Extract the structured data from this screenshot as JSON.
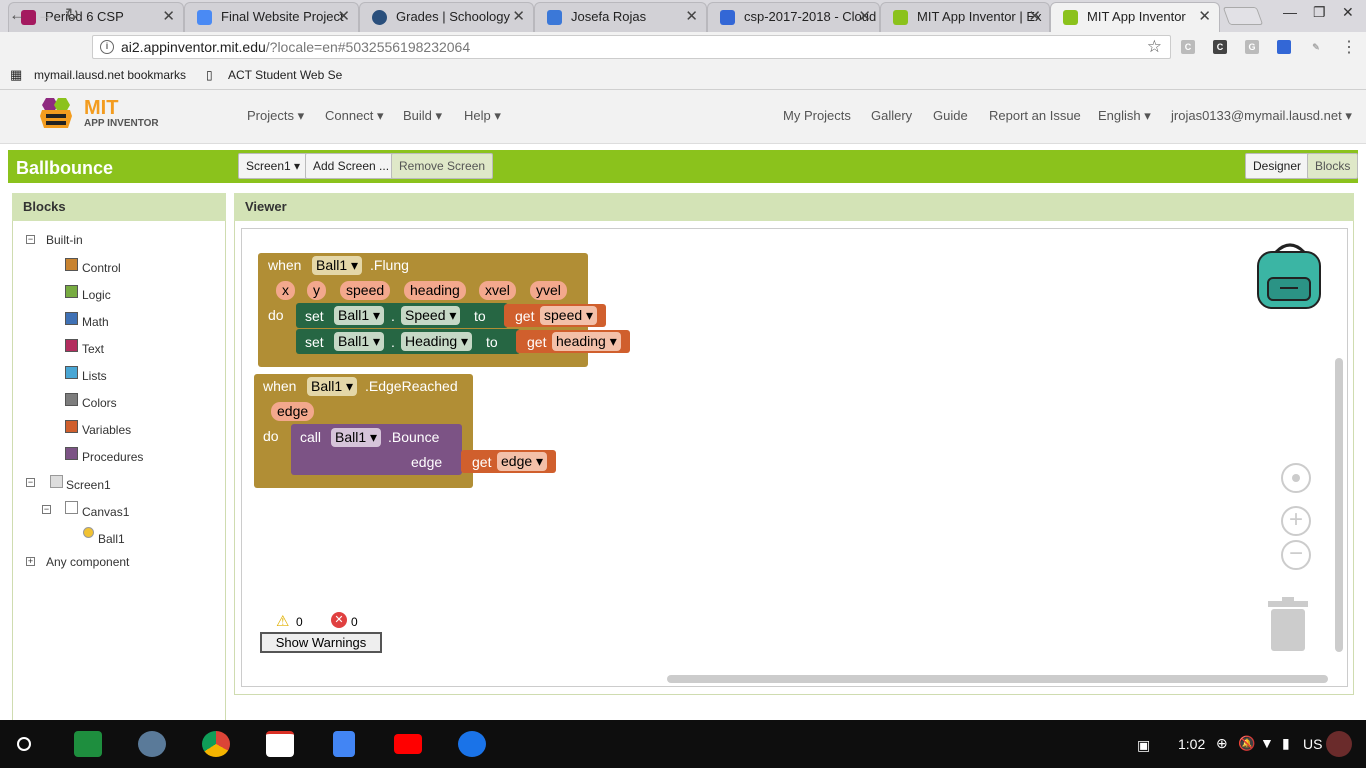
{
  "tabs": [
    {
      "label": "Period 6 CSP",
      "color": "#a4195f",
      "active": false
    },
    {
      "label": "Final Website Project",
      "color": "#4a8af4",
      "active": false
    },
    {
      "label": "Grades | Schoology",
      "color": "#2a4f7c",
      "active": false
    },
    {
      "label": "Josefa Rojas",
      "color": "#3b78d8",
      "active": false
    },
    {
      "label": "csp-2017-2018 - Cloud",
      "color": "#3367d6",
      "active": false
    },
    {
      "label": "MIT App Inventor | Ex",
      "color": "#8bc21c",
      "active": false
    },
    {
      "label": "MIT App Inventor",
      "color": "#8bc21c",
      "active": true
    }
  ],
  "address": {
    "host": "ai2.appinventor.mit.edu",
    "path": "/?locale=en#5032556198232064"
  },
  "bookmarks": [
    {
      "label": "mymail.lausd.net bookmarks"
    },
    {
      "label": "ACT Student Web Se"
    }
  ],
  "app": {
    "logo_top": "MIT",
    "logo_bottom": "APP INVENTOR"
  },
  "menus": [
    "Projects ▾",
    "Connect ▾",
    "Build ▾",
    "Help ▾"
  ],
  "right_menus": [
    "My Projects",
    "Gallery",
    "Guide",
    "Report an Issue",
    "English ▾",
    "jrojas0133@mymail.lausd.net ▾"
  ],
  "project": {
    "name": "Ballbounce",
    "screen": "Screen1 ▾",
    "add_screen": "Add Screen ...",
    "remove_screen": "Remove Screen",
    "designer": "Designer",
    "blocks": "Blocks"
  },
  "blocks_panel": {
    "title": "Blocks",
    "builtin": "Built-in",
    "categories": [
      {
        "label": "Control",
        "color": "#c88330"
      },
      {
        "label": "Logic",
        "color": "#77ab41"
      },
      {
        "label": "Math",
        "color": "#3f71b5"
      },
      {
        "label": "Text",
        "color": "#b32d5e"
      },
      {
        "label": "Lists",
        "color": "#49a6d4"
      },
      {
        "label": "Colors",
        "color": "#7d7d7d"
      },
      {
        "label": "Variables",
        "color": "#d05f2d"
      },
      {
        "label": "Procedures",
        "color": "#7c5385"
      }
    ],
    "screen": "Screen1",
    "canvas": "Canvas1",
    "ball": "Ball1",
    "any": "Any component"
  },
  "viewer": {
    "title": "Viewer",
    "warnings_count": "0",
    "errors_count": "0",
    "show_warnings": "Show Warnings"
  },
  "workspace": {
    "flung": {
      "when": "when",
      "component": "Ball1",
      "event": ".Flung",
      "params": [
        "x",
        "y",
        "speed",
        "heading",
        "xvel",
        "yvel"
      ],
      "do": "do",
      "set1": {
        "set": "set",
        "component": "Ball1",
        "dot": ".",
        "prop": "Speed",
        "to": "to",
        "get": "get",
        "var": "speed"
      },
      "set2": {
        "set": "set",
        "component": "Ball1",
        "dot": ".",
        "prop": "Heading",
        "to": "to",
        "get": "get",
        "var": "heading"
      }
    },
    "edge": {
      "when": "when",
      "component": "Ball1",
      "event": ".EdgeReached",
      "param": "edge",
      "do": "do",
      "call": "call",
      "call_component": "Ball1",
      "method": ".Bounce",
      "arg": "edge",
      "get": "get",
      "var": "edge"
    }
  },
  "taskbar": {
    "time": "1:02",
    "locale": "US"
  }
}
